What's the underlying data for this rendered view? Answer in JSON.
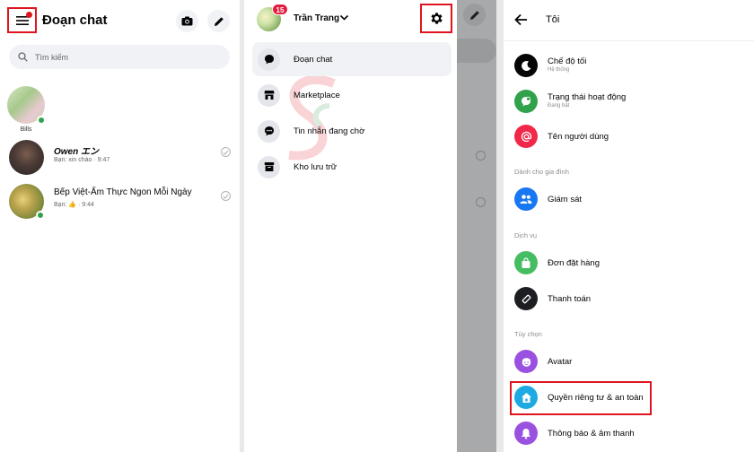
{
  "colors": {
    "highlight": "#e0141e",
    "online": "#31a24c",
    "badge": "#e41e3f"
  },
  "panel1": {
    "title": "Đoạn chat",
    "menu_icon": "hamburger-menu-icon",
    "camera_icon": "camera-icon",
    "compose_icon": "pencil-icon",
    "search_placeholder": "Tìm kiếm",
    "story": {
      "name": "Bills"
    },
    "chats": [
      {
        "name": "Owen エン",
        "preview": "Bạn: xin chào · 9:47",
        "online": false
      },
      {
        "name": "Bếp Việt-Ẩm Thực Ngon Mỗi Ngày",
        "preview": "Bạn: 👍 · 9:44",
        "online": true
      }
    ]
  },
  "panel2": {
    "user_name": "Trần Trang",
    "badge_count": "15",
    "settings_icon": "gear-icon",
    "menu": [
      {
        "label": "Đoạn chat",
        "icon": "chat-bubble-icon",
        "active": true
      },
      {
        "label": "Marketplace",
        "icon": "store-icon",
        "active": false
      },
      {
        "label": "Tin nhắn đang chờ",
        "icon": "pending-chat-icon",
        "active": false
      },
      {
        "label": "Kho lưu trữ",
        "icon": "archive-icon",
        "active": false
      }
    ]
  },
  "panel3": {
    "title": "Tôi",
    "items": [
      {
        "label": "Chế độ tối",
        "sub": "Hệ thống",
        "icon": "moon-icon",
        "color": "#050505"
      },
      {
        "label": "Trạng thái hoạt động",
        "sub": "Đang bật",
        "icon": "active-status-icon",
        "color": "#31a24c"
      },
      {
        "label": "Tên người dùng",
        "sub": "",
        "icon": "at-sign-icon",
        "color": "#f02849"
      }
    ],
    "sections": [
      {
        "title": "Dành cho gia đình",
        "items": [
          {
            "label": "Giám sát",
            "icon": "people-icon",
            "color": "#1877f2"
          }
        ]
      },
      {
        "title": "Dịch vụ",
        "items": [
          {
            "label": "Đơn đặt hàng",
            "icon": "shopping-bag-icon",
            "color": "#45bd62"
          },
          {
            "label": "Thanh toán",
            "icon": "payment-icon",
            "color": "#1c1e21"
          }
        ]
      },
      {
        "title": "Tùy chọn",
        "items": [
          {
            "label": "Avatar",
            "icon": "avatar-face-icon",
            "color": "#9b51e0"
          },
          {
            "label": "Quyền riêng tư & an toàn",
            "icon": "privacy-home-icon",
            "color": "#1fa9e3"
          },
          {
            "label": "Thông báo & âm thanh",
            "icon": "bell-icon",
            "color": "#9b51e0"
          }
        ]
      }
    ]
  }
}
